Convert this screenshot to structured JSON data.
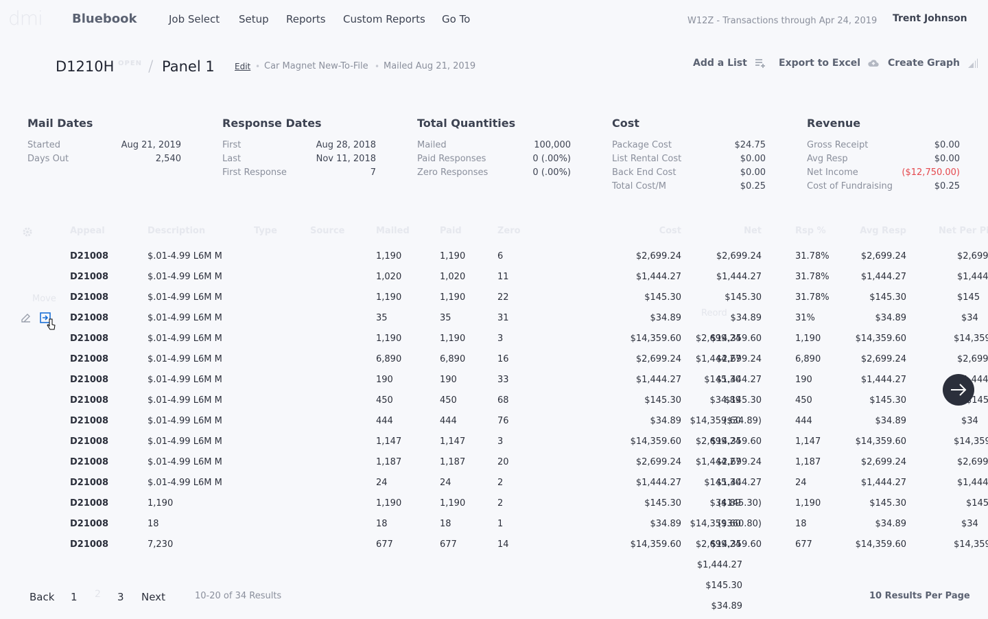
{
  "app": {
    "logo": "dmi",
    "brand": "Bluebook",
    "nav": [
      "Job Select",
      "Setup",
      "Reports",
      "Custom Reports",
      "Go To"
    ],
    "transactions": "W12Z - Transactions through Apr 24, 2019",
    "user": "Trent Johnson"
  },
  "header": {
    "code": "D1210H",
    "badge": "OPEN",
    "separator": "/",
    "panel": "Panel 1",
    "edit": "Edit",
    "list_name": "Car Magnet New-To-File",
    "mailed": "Mailed Aug 21, 2019",
    "actions": {
      "add_list": "Add a List",
      "export": "Export to Excel",
      "graph": "Create Graph"
    }
  },
  "summary": [
    {
      "title": "Mail Dates",
      "rows": [
        [
          "Started",
          "Aug 21, 2019"
        ],
        [
          "Days Out",
          "2,540"
        ]
      ]
    },
    {
      "title": "Response Dates",
      "rows": [
        [
          "First",
          "Aug 28, 2018"
        ],
        [
          "Last",
          "Nov 11, 2018"
        ],
        [
          "First Response",
          "7"
        ]
      ]
    },
    {
      "title": "Total Quantities",
      "rows": [
        [
          "Mailed",
          "100,000"
        ],
        [
          "Paid Responses",
          "0 (.00%)"
        ],
        [
          "Zero Responses",
          "0 (.00%)"
        ]
      ]
    },
    {
      "title": "Cost",
      "rows": [
        [
          "Package Cost",
          "$24.75"
        ],
        [
          "List Rental Cost",
          "$0.00"
        ],
        [
          "Back End Cost",
          "$0.00"
        ],
        [
          "Total Cost/M",
          "$0.25"
        ]
      ]
    },
    {
      "title": "Revenue",
      "rows": [
        [
          "Gross Receipt",
          "$0.00"
        ],
        [
          "Avg Resp",
          "$0.00"
        ],
        [
          "Net Income",
          "($12,750.00)"
        ],
        [
          "Cost of Fundraising",
          "$0.25"
        ]
      ]
    }
  ],
  "table": {
    "headers": [
      "Appeal",
      "Description",
      "Type",
      "Source",
      "Mailed",
      "Paid",
      "Zero",
      "Cost",
      "Net",
      "Rsp %",
      "Avg Resp",
      "Net Per Pi"
    ],
    "ghost_labels": {
      "move": "Move",
      "reorder": "Reord"
    },
    "rows": [
      [
        "D21008",
        "$.01-4.99 L6M M",
        "1,190",
        "1,190",
        "6",
        "$2,699.24",
        "",
        "$2,699.24",
        "31.78%",
        "$2,699.24",
        "$2,699"
      ],
      [
        "D21008",
        "$.01-4.99 L6M M",
        "1,020",
        "1,020",
        "11",
        "$1,444.27",
        "",
        "$1,444.27",
        "31.78%",
        "$1,444.27",
        "$1,444"
      ],
      [
        "D21008",
        "$.01-4.99 L6M M",
        "1,190",
        "1,190",
        "22",
        "$145.30",
        "",
        "$145.30",
        "31.78%",
        "$145.30",
        "$145"
      ],
      [
        "D21008",
        "$.01-4.99 L6M M",
        "35",
        "35",
        "31",
        "$34.89",
        "",
        "$34.89",
        "31%",
        "$34.89",
        "$34"
      ],
      [
        "D21008",
        "$.01-4.99 L6M M",
        "1,190",
        "1,190",
        "3",
        "$14,359.60",
        "$2,699.24",
        "$14,359.60",
        "1,190",
        "$14,359.60",
        "$14,359"
      ],
      [
        "D21008",
        "$.01-4.99 L6M M",
        "6,890",
        "6,890",
        "16",
        "$2,699.24",
        "$1,444.27",
        "$2,699.24",
        "6,890",
        "$2,699.24",
        "$2,699"
      ],
      [
        "D21008",
        "$.01-4.99 L6M M",
        "190",
        "190",
        "33",
        "$1,444.27",
        "$145.30",
        "$1,444.27",
        "190",
        "$1,444.27",
        "$1,444"
      ],
      [
        "D21008",
        "$.01-4.99 L6M M",
        "450",
        "450",
        "68",
        "$145.30",
        "$34.89",
        "$145.30",
        "450",
        "$145.30",
        "$145"
      ],
      [
        "D21008",
        "$.01-4.99 L6M M",
        "444",
        "444",
        "76",
        "$34.89",
        "$14,359.60",
        "($34.89)",
        "444",
        "$34.89",
        "$34"
      ],
      [
        "D21008",
        "$.01-4.99 L6M M",
        "1,147",
        "1,147",
        "3",
        "$14,359.60",
        "$2,699.24",
        "$14,359.60",
        "1,147",
        "$14,359.60",
        "$14,359"
      ],
      [
        "D21008",
        "$.01-4.99 L6M M",
        "1,187",
        "1,187",
        "20",
        "$2,699.24",
        "$1,444.27",
        "$2,699.24",
        "1,187",
        "$2,699.24",
        "$2,699"
      ],
      [
        "D21008",
        "$.01-4.99 L6M M",
        "24",
        "24",
        "2",
        "$1,444.27",
        "$145.30",
        "$1,444.27",
        "24",
        "$1,444.27",
        "$1,444"
      ],
      [
        "D21008",
        "1,190",
        "1,190",
        "1,190",
        "2",
        "$145.30",
        "$34.89",
        "($145.30)",
        "1,190",
        "$145.30",
        "$145"
      ],
      [
        "D21008",
        "18",
        "18",
        "18",
        "1",
        "$34.89",
        "$14,359.60",
        "($360.80)",
        "18",
        "$34.89",
        "$34"
      ],
      [
        "D21008",
        "7,230",
        "677",
        "677",
        "14",
        "$14,359.60",
        "$2,699.24",
        "$14,359.60",
        "677",
        "$14,359.60",
        "$14,359"
      ]
    ],
    "overflow": [
      "$1,444.27",
      "$145.30",
      "$34.89"
    ]
  },
  "pagination": {
    "back": "Back",
    "pages": [
      "1",
      "2",
      "3"
    ],
    "next": "Next",
    "results": "10-20 of 34 Results",
    "per_page": "10 Results Per Page"
  },
  "colors": {
    "positive": "#34b04a",
    "negative": "#e5484d",
    "icon_active": "#1a6fd6"
  }
}
